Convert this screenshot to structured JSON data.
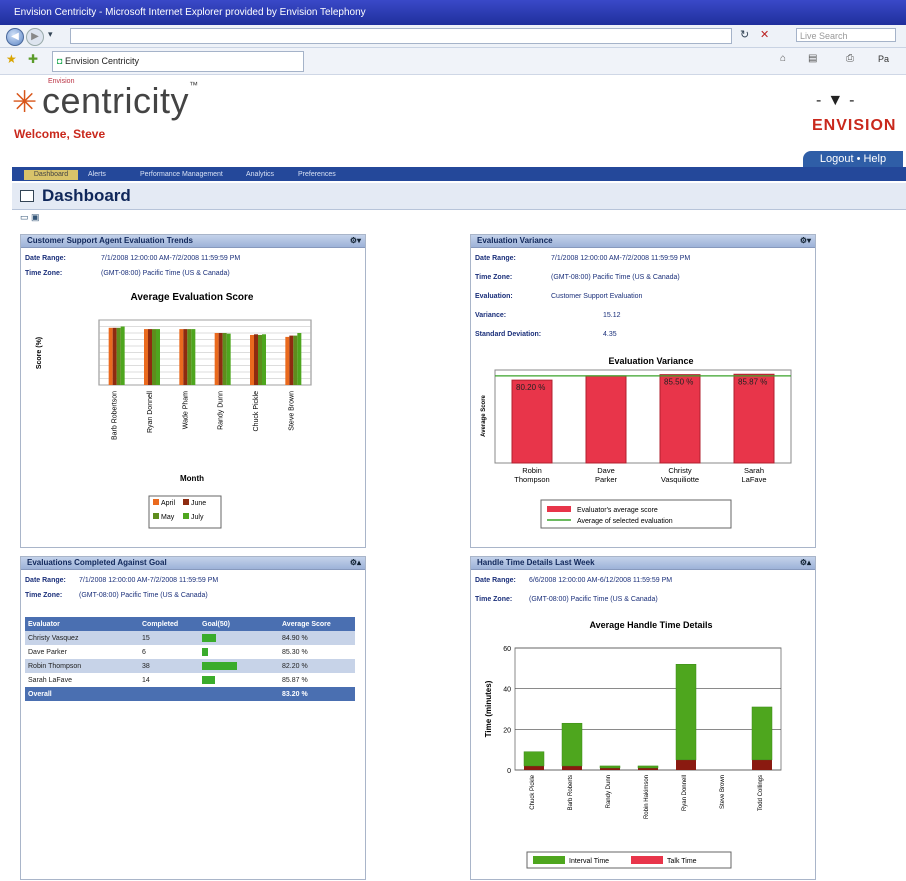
{
  "window": {
    "title": "Envision Centricity - Microsoft Internet Explorer provided by Envision Telephony"
  },
  "browser": {
    "search_placeholder": "Live Search",
    "tab_title": "Envision Centricity",
    "toolbar_right": "Pa"
  },
  "header": {
    "brand_small": "Envision",
    "brand": "centricity",
    "trademark": "™",
    "welcome": "Welcome, Steve",
    "company": "ENVISION",
    "logout_help": "Logout • Help"
  },
  "nav": {
    "tabs": [
      "Dashboard",
      "Alerts",
      "Performance Management",
      "Analytics",
      "Preferences"
    ]
  },
  "page": {
    "title": "Dashboard"
  },
  "panels": {
    "trends": {
      "title": "Customer Support Agent Evaluation Trends",
      "date_label": "Date Range:",
      "date_value": "7/1/2008 12:00:00 AM-7/2/2008 11:59:59 PM",
      "tz_label": "Time Zone:",
      "tz_value": "(GMT-08:00) Pacific Time (US & Canada)"
    },
    "variance": {
      "title": "Evaluation Variance",
      "date_label": "Date Range:",
      "date_value": "7/1/2008 12:00:00 AM-7/2/2008 11:59:59 PM",
      "tz_label": "Time Zone:",
      "tz_value": "(GMT-08:00) Pacific Time (US & Canada)",
      "evaluation_label": "Evaluation:",
      "evaluation_value": "Customer Support Evaluation",
      "variance_label": "Variance:",
      "variance_value": "15.12",
      "stddev_label": "Standard Deviation:",
      "stddev_value": "4.35"
    },
    "completed": {
      "title": "Evaluations Completed Against Goal",
      "date_label": "Date Range:",
      "date_value": "7/1/2008 12:00:00 AM-7/2/2008 11:59:59 PM",
      "tz_label": "Time Zone:",
      "tz_value": "(GMT-08:00) Pacific Time (US & Canada)",
      "columns": [
        "Evaluator",
        "Completed",
        "Goal(50)",
        "Average Score"
      ],
      "rows": [
        {
          "evaluator": "Christy Vasquez",
          "completed": "15",
          "goal_fraction": 0.3,
          "avg": "84.90 %"
        },
        {
          "evaluator": "Dave Parker",
          "completed": "6",
          "goal_fraction": 0.12,
          "avg": "85.30 %"
        },
        {
          "evaluator": "Robin Thompson",
          "completed": "38",
          "goal_fraction": 0.76,
          "avg": "82.20 %"
        },
        {
          "evaluator": "Sarah LaFave",
          "completed": "14",
          "goal_fraction": 0.28,
          "avg": "85.87 %"
        }
      ],
      "total_label": "Overall",
      "total_avg": "83.20 %"
    },
    "handle": {
      "title": "Handle Time Details Last Week",
      "date_label": "Date Range:",
      "date_value": "6/6/2008 12:00:00 AM-6/12/2008 11:59:59 PM",
      "tz_label": "Time Zone:",
      "tz_value": "(GMT-08:00) Pacific Time (US & Canada)"
    }
  },
  "colors": {
    "orange": "#ea6a1e",
    "brown": "#8e2b10",
    "olive": "#5e8d1d",
    "green": "#4ea61e",
    "red": "#e8354a",
    "darkred": "#8a1a10"
  },
  "chart_data": [
    {
      "type": "bar",
      "title": "Average Evaluation Score",
      "xlabel": "Month",
      "ylabel": "Score (%)",
      "categories": [
        "Barb Robertson",
        "Ryan Donnell",
        "Wade Pham",
        "Randy Dunn",
        "Chuck Pickle",
        "Steve Brown"
      ],
      "series": [
        {
          "name": "April",
          "values": [
            88,
            86,
            86,
            80,
            77,
            74
          ]
        },
        {
          "name": "June",
          "values": [
            88,
            86,
            86,
            80,
            78,
            76
          ]
        },
        {
          "name": "May",
          "values": [
            88,
            86,
            86,
            80,
            77,
            76
          ]
        },
        {
          "name": "July",
          "values": [
            90,
            86,
            86,
            79,
            78,
            80
          ]
        }
      ],
      "ylim": [
        0,
        100
      ]
    },
    {
      "type": "bar",
      "title": "Evaluation Variance",
      "ylabel": "Average Score",
      "categories": [
        "Robin Thompson",
        "Dave Parker",
        "Christy Vasquiliotte",
        "Sarah LaFave"
      ],
      "values": [
        80.2,
        84.3,
        85.5,
        85.87
      ],
      "data_labels": [
        "80.20 %",
        "",
        "85.50 %",
        "85.87 %"
      ],
      "reference_value": 84.3,
      "legend": [
        "Evaluator's average score",
        "Average of selected evaluation"
      ],
      "ylim": [
        0,
        90
      ]
    },
    {
      "type": "bar",
      "title": "Average Handle Time Details",
      "ylabel": "Time (minutes)",
      "categories": [
        "Chuck Pickle",
        "Barb Roberts",
        "Randy Dunn",
        "Robin Hakimson",
        "Ryan Donnell",
        "Steve Brown",
        "Todd Collings"
      ],
      "series": [
        {
          "name": "Interval Time",
          "values": [
            7,
            21,
            1,
            1,
            47,
            0,
            26
          ]
        },
        {
          "name": "Talk Time",
          "values": [
            2,
            2,
            1,
            1,
            5,
            0,
            5
          ]
        }
      ],
      "data_labels": [
        "",
        "",
        "",
        "",
        "",
        "",
        ""
      ],
      "ylim": [
        0,
        60
      ],
      "yticks": [
        0,
        20,
        40,
        60
      ]
    }
  ]
}
